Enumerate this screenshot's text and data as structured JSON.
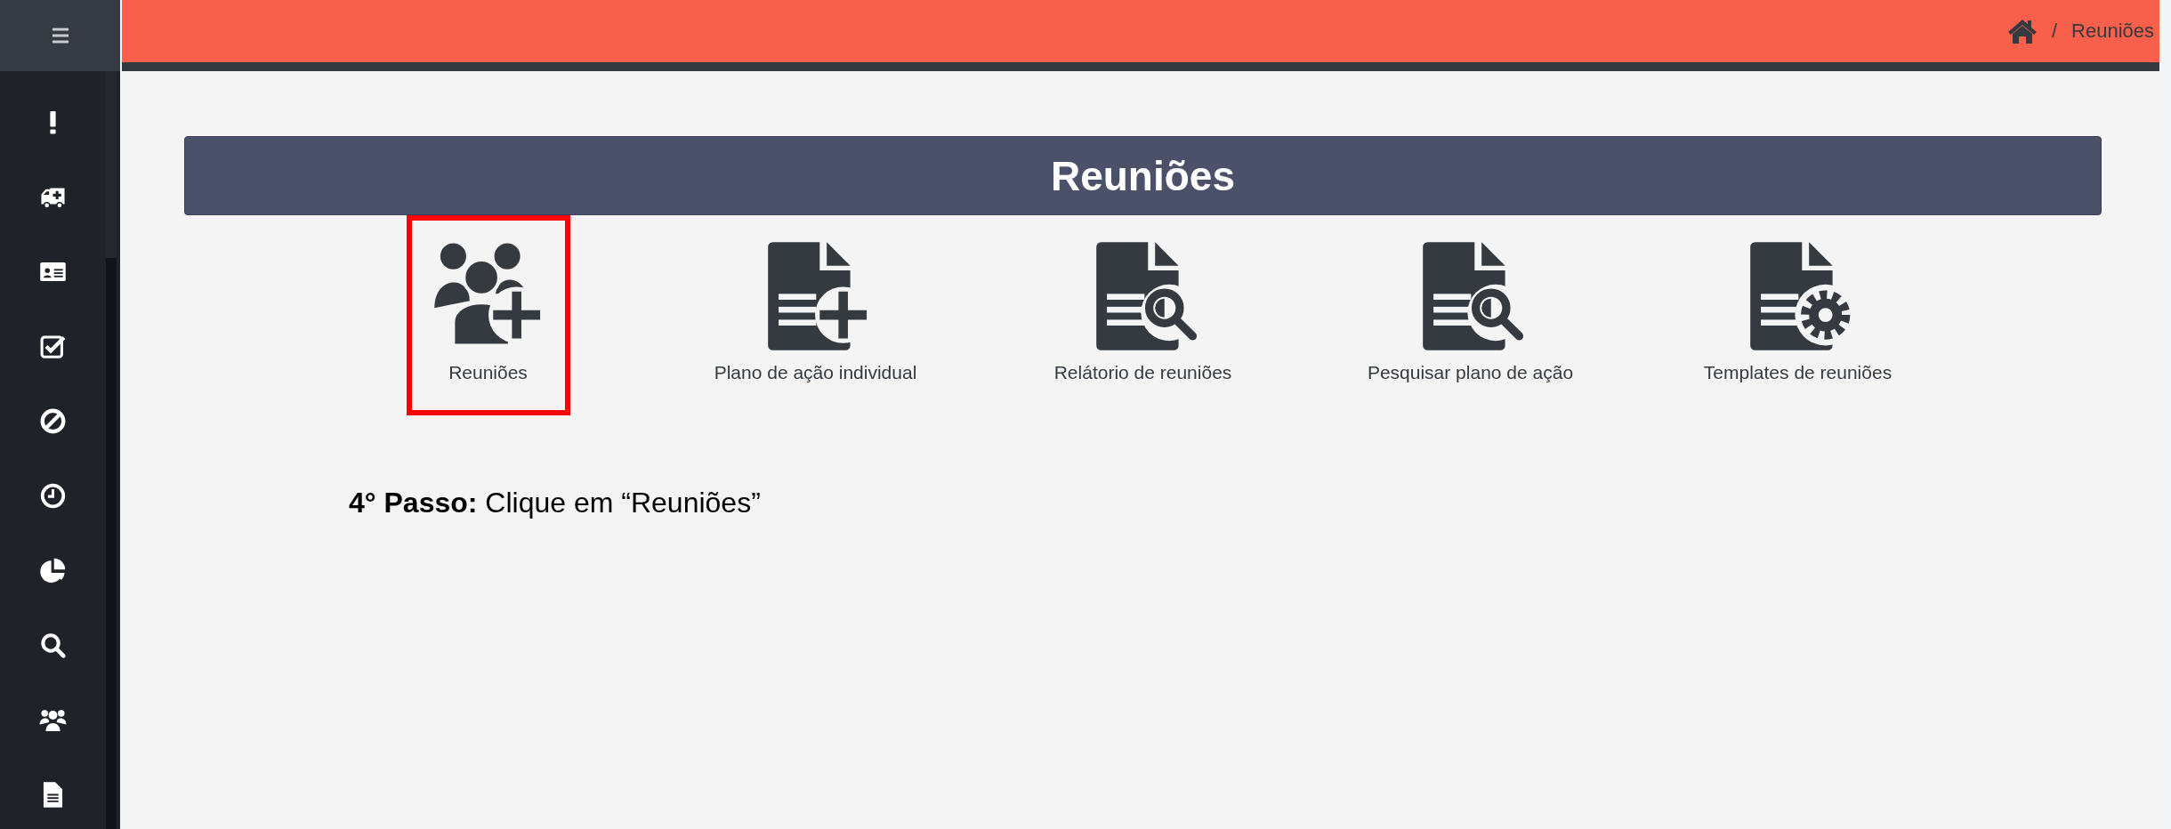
{
  "breadcrumb": {
    "separator": "/",
    "current": "Reuniões"
  },
  "page_title": "Reuniões",
  "tiles": [
    {
      "label": "Reuniões",
      "highlighted": true
    },
    {
      "label": "Plano de ação individual",
      "highlighted": false
    },
    {
      "label": "Relátorio de reuniões",
      "highlighted": false
    },
    {
      "label": "Pesquisar plano de ação",
      "highlighted": false
    },
    {
      "label": "Templates de reuniões",
      "highlighted": false
    }
  ],
  "instruction": "**4° Passo:** Clique em “Reuniões”"
}
